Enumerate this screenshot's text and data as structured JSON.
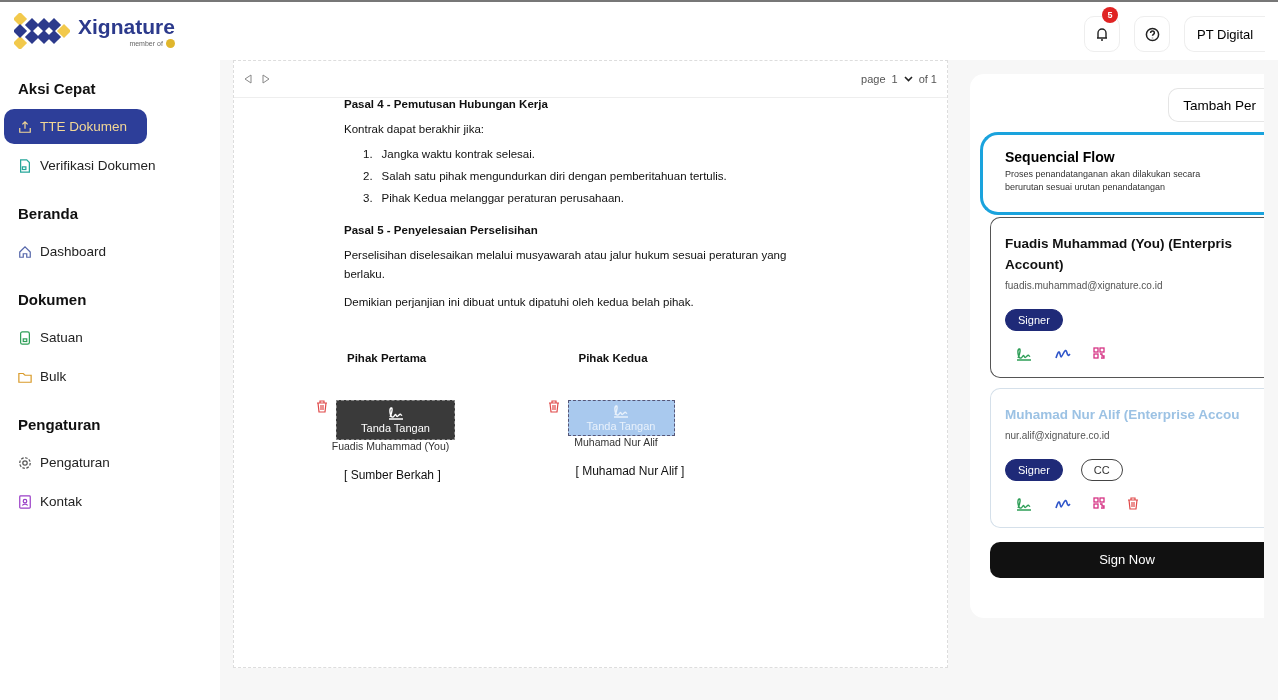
{
  "brand": {
    "name": "Xignature",
    "tagline": "member of"
  },
  "header": {
    "notifications": "5",
    "company": "PT Digital"
  },
  "sidebar": [
    {
      "heading": "Aksi Cepat",
      "items": [
        {
          "label": "TTE Dokumen",
          "selected": true
        },
        {
          "label": "Verifikasi Dokumen",
          "selected": false
        }
      ]
    },
    {
      "heading": "Beranda",
      "items": [
        {
          "label": "Dashboard",
          "selected": false
        }
      ]
    },
    {
      "heading": "Dokumen",
      "items": [
        {
          "label": "Satuan",
          "selected": false
        },
        {
          "label": "Bulk",
          "selected": false
        }
      ]
    },
    {
      "heading": "Pengaturan",
      "items": [
        {
          "label": "Pengaturan",
          "selected": false
        },
        {
          "label": "Kontak",
          "selected": false
        }
      ]
    }
  ],
  "viewer": {
    "page_label": "page",
    "page": "1",
    "of": "of 1"
  },
  "document": {
    "blocks": [
      {
        "kind": "heading",
        "text": "Pasal 4 - Pemutusan Hubungan Kerja"
      },
      {
        "kind": "para",
        "text": "Kontrak dapat berakhir jika:"
      },
      {
        "kind": "list",
        "items": [
          "Jangka waktu kontrak selesai.",
          "Salah satu pihak mengundurkan diri dengan pemberitahuan tertulis.",
          "Pihak Kedua melanggar peraturan perusahaan."
        ],
        "numbers": [
          "1.",
          "2.",
          "3."
        ]
      },
      {
        "kind": "heading",
        "text": "Pasal 5 - Penyelesaian Perselisihan"
      },
      {
        "kind": "para",
        "text": "Perselisihan diselesaikan melalui musyawarah atau jalur hukum sesuai peraturan yang berlaku."
      },
      {
        "kind": "para",
        "text": "Demikian perjanjian ini dibuat untuk dipatuhi oleh kedua belah pihak."
      }
    ],
    "parties": [
      {
        "title": "Pihak Pertama",
        "field_label": "Tanda Tangan",
        "signer": "Fuadis Muhammad (You)",
        "name": "[ Sumber Berkah ]",
        "active": true
      },
      {
        "title": "Pihak Kedua",
        "field_label": "Tanda Tangan",
        "signer": "Muhamad Nur Alif",
        "name": "[ Muhamad Nur Alif ]",
        "active": false
      }
    ]
  },
  "panel": {
    "add_button": "Tambah Per",
    "flow": {
      "title": "Sequencial Flow",
      "description": "Proses penandatanganan akan dilakukan secara berurutan sesuai urutan penandatangan"
    },
    "signers": [
      {
        "name_lines": [
          "Fuadis Muhammad (You) (Enterpris",
          "Account)"
        ],
        "email": "fuadis.muhammad@xignature.co.id",
        "roles": [
          {
            "label": "Signer",
            "selected": true
          }
        ],
        "active": true,
        "deletable": false
      },
      {
        "name_lines": [
          "Muhamad Nur Alif (Enterprise Accou"
        ],
        "email": "nur.alif@xignature.co.id",
        "roles": [
          {
            "label": "Signer",
            "selected": true
          },
          {
            "label": "CC",
            "selected": false
          }
        ],
        "active": false,
        "deletable": true
      }
    ],
    "sign_button": "Sign Now"
  }
}
